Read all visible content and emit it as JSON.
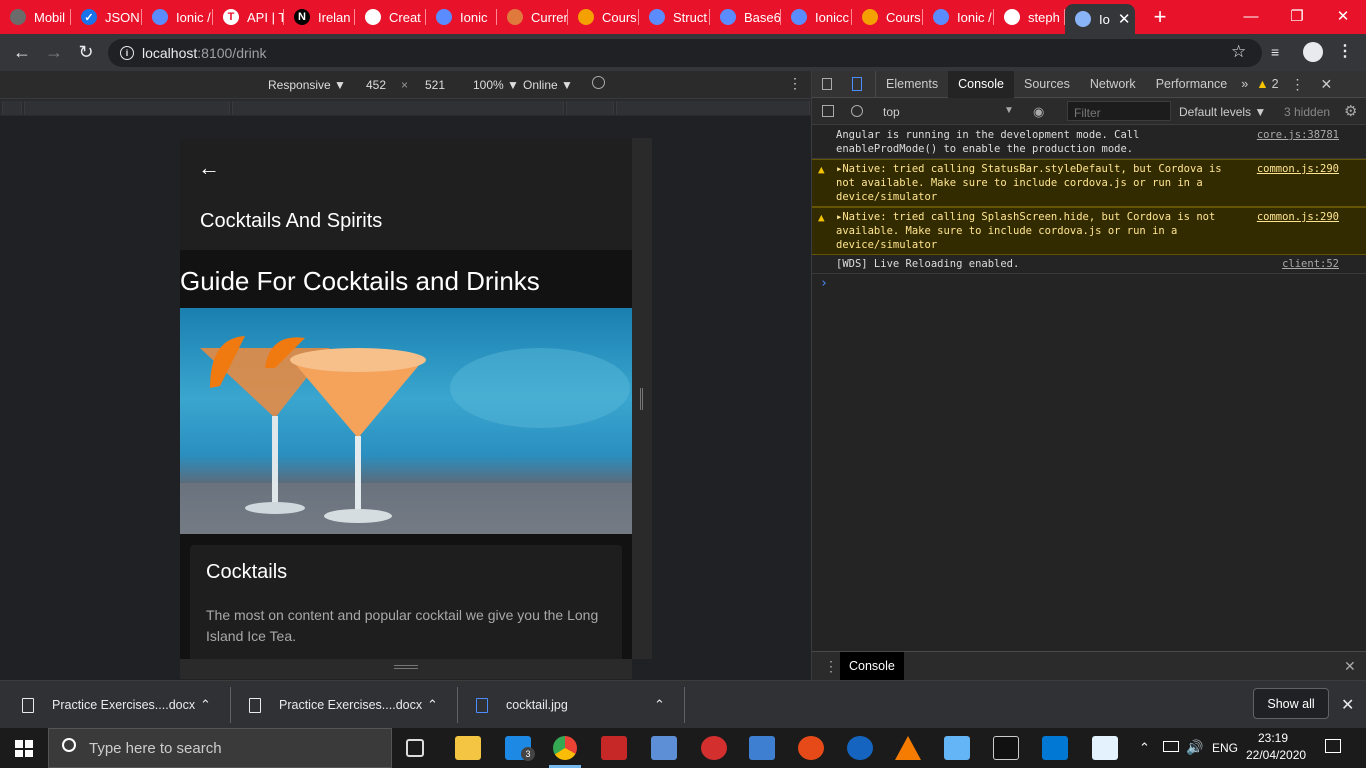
{
  "browser": {
    "tabs": [
      {
        "label": "Mobil",
        "color": "#6b6b6b",
        "glyph": ""
      },
      {
        "label": "JSON",
        "color": "#1a73e8",
        "glyph": "✓"
      },
      {
        "label": "Ionic /",
        "color": "#5b8cff",
        "glyph": ""
      },
      {
        "label": "API | T",
        "color": "#ffffff",
        "glyph": "T"
      },
      {
        "label": "Irelan",
        "color": "#000000",
        "glyph": "N"
      },
      {
        "label": "Creat",
        "color": "#ffffff",
        "glyph": ""
      },
      {
        "label": "Ionic",
        "color": "#5b8cff",
        "glyph": ""
      },
      {
        "label": "Currer",
        "color": "#e07a3c",
        "glyph": ""
      },
      {
        "label": "Cours",
        "color": "#f4a000",
        "glyph": ""
      },
      {
        "label": "Struct",
        "color": "#5b8cff",
        "glyph": ""
      },
      {
        "label": "Base6",
        "color": "#5b8cff",
        "glyph": ""
      },
      {
        "label": "Ionicc",
        "color": "#5b8cff",
        "glyph": ""
      },
      {
        "label": "Cours",
        "color": "#f4a000",
        "glyph": ""
      },
      {
        "label": "Ionic /",
        "color": "#5b8cff",
        "glyph": ""
      },
      {
        "label": "steph",
        "color": "#ffffff",
        "glyph": ""
      }
    ],
    "active_tab": {
      "label": "Io",
      "close": "✕"
    },
    "new_tab": "+",
    "url_host": "localhost",
    "url_path": ":8100/drink"
  },
  "device_toolbar": {
    "mode": "Responsive ▼",
    "width": "452",
    "times": "×",
    "height": "521",
    "zoom": "100% ▼",
    "network": "Online ▼"
  },
  "app": {
    "header_title": "Cocktails And Spirits",
    "heading": "Guide For Cocktails and Drinks",
    "card_title": "Cocktails",
    "card_body": "The most on content and popular cocktail we give you the Long Island Ice Tea."
  },
  "devtools": {
    "tabs": [
      "Elements",
      "Console",
      "Sources",
      "Network",
      "Performance"
    ],
    "active_tab": "Console",
    "more": "»",
    "warning_count": "2",
    "context": "top",
    "filter_placeholder": "Filter",
    "levels": "Default levels ▼",
    "hidden": "3 hidden",
    "console": [
      {
        "type": "log",
        "text": "Angular is running in the development mode. Call enableProdMode() to enable the production mode.",
        "source": "core.js:38781"
      },
      {
        "type": "warn",
        "text": "▸Native: tried calling StatusBar.styleDefault, but Cordova is not available. Make sure to include cordova.js or run in a device/simulator",
        "source": "common.js:290"
      },
      {
        "type": "warn",
        "text": "▸Native: tried calling SplashScreen.hide, but Cordova is not available. Make sure to include cordova.js or run in a device/simulator",
        "source": "common.js:290"
      },
      {
        "type": "log",
        "text": "[WDS] Live Reloading enabled.",
        "source": "client:52"
      }
    ],
    "prompt": "›",
    "drawer_tab": "Console"
  },
  "downloads": {
    "items": [
      {
        "name": "Practice Exercises....docx"
      },
      {
        "name": "Practice Exercises....docx"
      },
      {
        "name": "cocktail.jpg"
      }
    ],
    "show_all": "Show all"
  },
  "taskbar": {
    "search_placeholder": "Type here to search",
    "mail_badge": "3",
    "language": "ENG",
    "time": "23:19",
    "date": "22/04/2020"
  }
}
